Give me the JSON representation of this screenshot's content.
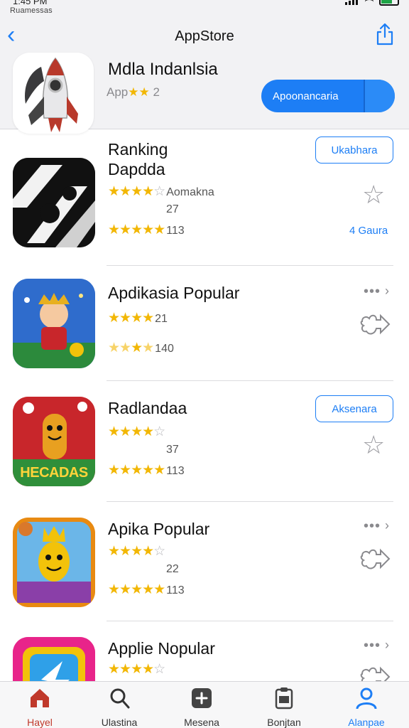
{
  "status_bar": {
    "time": "1:45 PM",
    "carrier": "Ruamessas"
  },
  "nav": {
    "back_icon": "chevron-left-icon",
    "title": "AppStore",
    "share_icon": "share-icon"
  },
  "featured": {
    "title": "Mdla Indanlsia",
    "subtitle_prefix": "App",
    "subtitle_stars": "★★",
    "subtitle_count": "2",
    "button_label": "Apoonancaria",
    "icon": "rocket-icon"
  },
  "apps": [
    {
      "title_line1": "Ranking",
      "title_line2": "Dapdda",
      "stars_text": "Aomakna",
      "count_1": "27",
      "count_2": "113",
      "button_label": "Ukabhara",
      "side_icon": "star-outline-icon",
      "link_label": "4 Gaura",
      "icon": "dark-abstract-app-icon"
    },
    {
      "title": "Apdikasia Popular",
      "count_1": "21",
      "count_2": "140",
      "side_icon": "share-out-icon",
      "more_icon": "more-icon",
      "icon": "cartoon-boy-app-icon"
    },
    {
      "title": "Radlandaa",
      "count_1": "37",
      "count_2": "113",
      "button_label": "Aksenara",
      "side_icon": "star-outline-icon",
      "icon_caption": "HECADAS",
      "icon": "cartoon-stick-app-icon"
    },
    {
      "title": "Apika Popular",
      "count_1": "22",
      "count_2": "113",
      "side_icon": "share-out-icon",
      "more_icon": "more-icon",
      "icon": "banana-king-app-icon"
    },
    {
      "title": "Applie Nopular",
      "more_icon": "more-icon",
      "side_icon": "share-out-icon",
      "icon": "colorful-square-app-icon"
    }
  ],
  "tabs": [
    {
      "label": "Hayel",
      "icon": "home-icon"
    },
    {
      "label": "Ulastina",
      "icon": "search-icon"
    },
    {
      "label": "Mesena",
      "icon": "plus-square-icon"
    },
    {
      "label": "Bonjtan",
      "icon": "clipboard-icon"
    },
    {
      "label": "Alanpae",
      "icon": "person-icon"
    }
  ],
  "colors": {
    "accent": "#1d7ef5",
    "star": "#f2b705",
    "active_tab_home": "#c0392b"
  }
}
